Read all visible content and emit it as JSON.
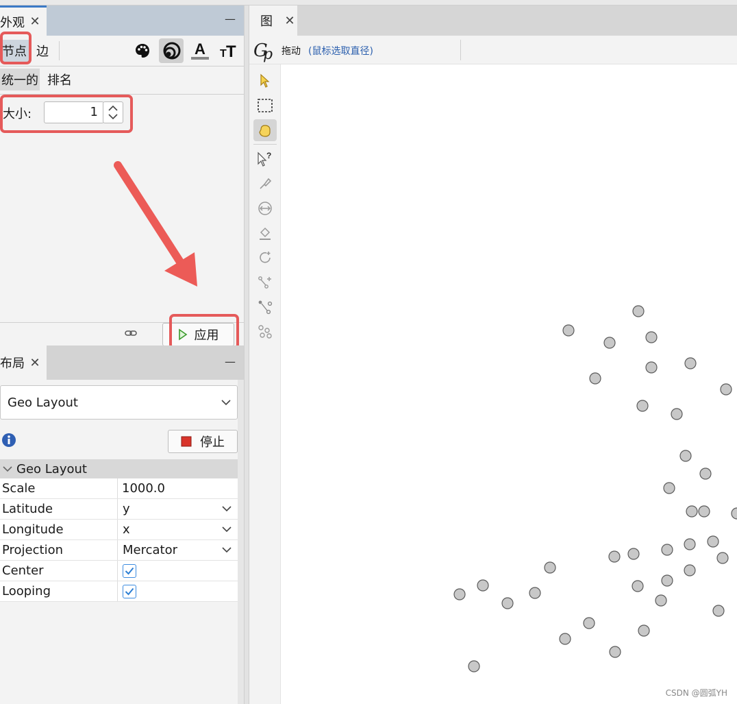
{
  "appearance_panel": {
    "title": "外观",
    "tabs": [
      "节点",
      "边"
    ],
    "subtabs": [
      "统一的",
      "排名"
    ],
    "size_label": "大小:",
    "size_value": "1",
    "apply_label": "应用"
  },
  "layout_panel": {
    "title": "布局",
    "selected_layout": "Geo Layout",
    "stop_label": "停止",
    "group_title": "Geo Layout",
    "properties": [
      {
        "name": "Scale",
        "value": "1000.0"
      },
      {
        "name": "Latitude",
        "value": "y"
      },
      {
        "name": "Longitude",
        "value": "x"
      },
      {
        "name": "Projection",
        "value": "Mercator"
      },
      {
        "name": "Center",
        "value": ""
      },
      {
        "name": "Looping",
        "value": ""
      }
    ],
    "center_checked": true,
    "looping_checked": true
  },
  "graph_panel": {
    "title": "图",
    "mode_label": "拖动",
    "mode_hint": "(鼠标选取直径)"
  },
  "colors": {
    "highlight": "#e55a5a",
    "node_fill": "#c8c8c8",
    "node_stroke": "#5a5a5a",
    "panel_header": "#bfcad6"
  },
  "watermark": "CSDN @圆弧YH"
}
